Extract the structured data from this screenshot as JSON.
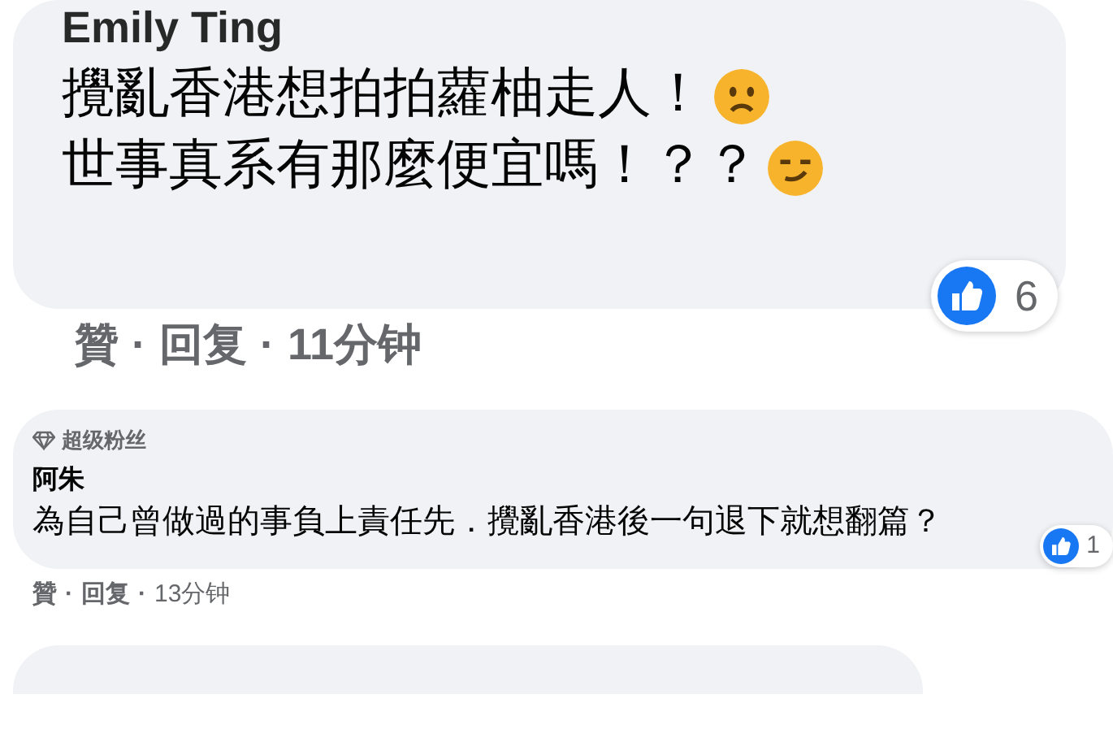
{
  "comments": [
    {
      "kind": "large",
      "author": "Emily Ting",
      "lines": [
        {
          "text": "攪亂香港想拍拍蘿柚走人！",
          "kind": "frown"
        },
        {
          "text": "世事真系有那麼便宜嗎！？？",
          "kind": "smirk"
        }
      ],
      "actions": [
        {
          "kind": "like",
          "label": "贊"
        },
        {
          "kind": "sep",
          "label": "·"
        },
        {
          "kind": "reply",
          "label": "回复"
        },
        {
          "kind": "sep",
          "label": "·"
        },
        {
          "kind": "time",
          "label": "11分钟"
        }
      ],
      "reactions": "6"
    },
    {
      "kind": "small",
      "badge": "超级粉丝",
      "author": "阿朱",
      "lines": [
        {
          "text": "為自己曾做過的事負上責任先．攪亂香港後一句退下就想翻篇？",
          "kind": "plain"
        }
      ],
      "actions": [
        {
          "kind": "like",
          "label": "贊"
        },
        {
          "kind": "sep",
          "label": "·"
        },
        {
          "kind": "reply",
          "label": "回复"
        },
        {
          "kind": "sep",
          "label": "·"
        },
        {
          "kind": "time",
          "label": "13分钟"
        }
      ],
      "reactions": "1"
    }
  ]
}
